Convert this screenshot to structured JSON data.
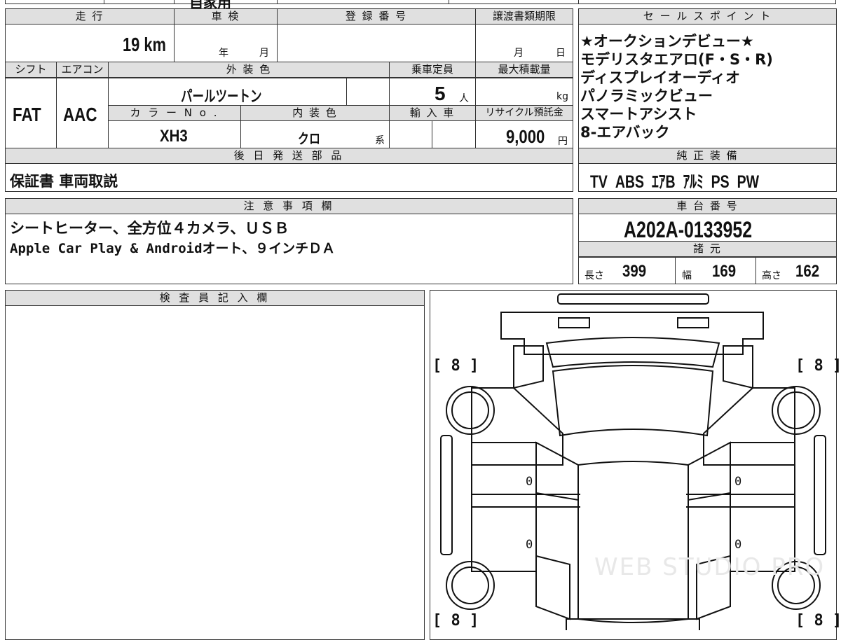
{
  "top_strip": {
    "partial_text": "自家用"
  },
  "mileage": {
    "header": "走 行",
    "value": "19 km"
  },
  "inspection": {
    "header": "車 検",
    "year_label": "年",
    "month_label": "月"
  },
  "registration": {
    "header": "登 録 番 号",
    "value": ""
  },
  "transfer": {
    "header": "譲渡書類期限",
    "month_label": "月",
    "day_label": "日"
  },
  "sales_points": {
    "header": "セ ー ル ス ポ イ ン ト",
    "items": [
      "★オークションデビュー★",
      "モデリスタエアロ(F・S・R)",
      "ディスプレイオーディオ",
      "パノラミックビュー",
      "スマートアシスト",
      "8-エアバック"
    ]
  },
  "shift": {
    "header": "シフト",
    "value": "FAT"
  },
  "aircon": {
    "header": "エアコン",
    "value": "AAC"
  },
  "exterior_color": {
    "header": "外 装 色",
    "value": "パールツートン"
  },
  "capacity": {
    "header": "乗車定員",
    "value": "5",
    "unit": "人"
  },
  "max_load": {
    "header": "最大積載量",
    "value": "",
    "unit": "kg"
  },
  "color_no": {
    "header": "カ ラ ー N o .",
    "value": "XH3"
  },
  "interior_color": {
    "header": "内 装 色",
    "value": "クロ",
    "suffix": "系"
  },
  "imported": {
    "header": "輸 入 車"
  },
  "recycle": {
    "header": "リサイクル預託金",
    "value": "9,000",
    "unit": "円"
  },
  "later_parts": {
    "header": "後 日 発 送 部 品",
    "value": "保証書 車両取説"
  },
  "genuine_equipment": {
    "header": "純 正 装 備",
    "items": [
      "TV",
      "ABS",
      "ｴｱB",
      "ｱﾙﾐ",
      "PS",
      "PW"
    ]
  },
  "notes": {
    "header": "注 意 事 項 欄",
    "lines": [
      "シートヒーター、全方位４カメラ、ＵＳＢ",
      "Apple Car Play & Androidオート、９インチＤＡ"
    ]
  },
  "chassis": {
    "header": "車 台 番 号",
    "value": "A202A-0133952"
  },
  "specs": {
    "header": "諸 元",
    "length_label": "長さ",
    "length": "399",
    "width_label": "幅",
    "width": "169",
    "height_label": "高さ",
    "height": "162"
  },
  "inspector": {
    "header": "検 査 員 記 入 欄"
  },
  "diagram": {
    "tire_marks": [
      "[ 8 ]",
      "[ 8 ]",
      "[ 8 ]",
      "[ 8 ]"
    ],
    "door_marks": [
      "0",
      "0",
      "0",
      "0"
    ],
    "watermark": "WEB STUDIO PRO"
  }
}
